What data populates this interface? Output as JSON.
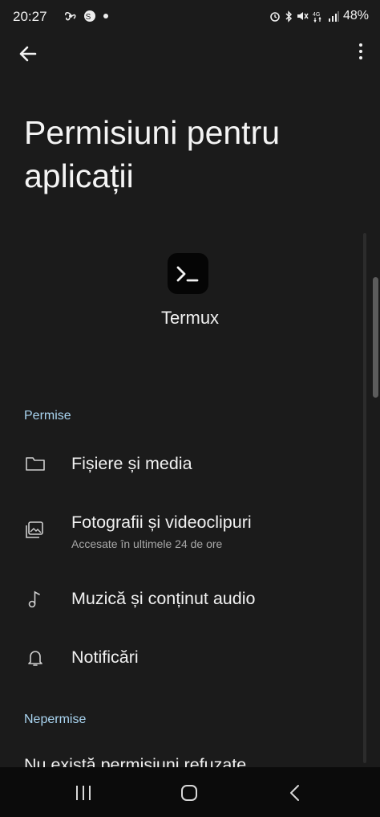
{
  "status_bar": {
    "time": "20:27",
    "left_icons": [
      "fan-icon",
      "skype-icon",
      "dot-icon"
    ],
    "right_icons": [
      "alarm-icon",
      "bluetooth-icon",
      "mute-icon",
      "network-4g-icon",
      "signal-icon"
    ],
    "battery": "48%"
  },
  "toolbar": {
    "back_icon": "arrow-left-icon",
    "menu_icon": "more-vert-icon"
  },
  "page": {
    "title": "Permisiuni pentru aplicații"
  },
  "app": {
    "name": "Termux",
    "icon": "terminal-icon"
  },
  "sections": {
    "allowed": {
      "label": "Permise",
      "items": [
        {
          "label": "Fișiere și media",
          "sub": "",
          "icon": "folder-icon"
        },
        {
          "label": "Fotografii și videoclipuri",
          "sub": "Accesate în ultimele 24 de ore",
          "icon": "image-icon"
        },
        {
          "label": "Muzică și conținut audio",
          "sub": "",
          "icon": "music-note-icon"
        },
        {
          "label": "Notificări",
          "sub": "",
          "icon": "bell-icon"
        }
      ]
    },
    "denied": {
      "label": "Nepermise",
      "empty_text": "Nu există permisiuni refuzate"
    }
  },
  "nav": {
    "recents_icon": "recents-icon",
    "home_icon": "home-icon",
    "back_icon": "back-chevron-icon"
  },
  "colors": {
    "background": "#1b1b1b",
    "section_accent": "#a9d4f0",
    "navbar": "#0b0b0b"
  }
}
